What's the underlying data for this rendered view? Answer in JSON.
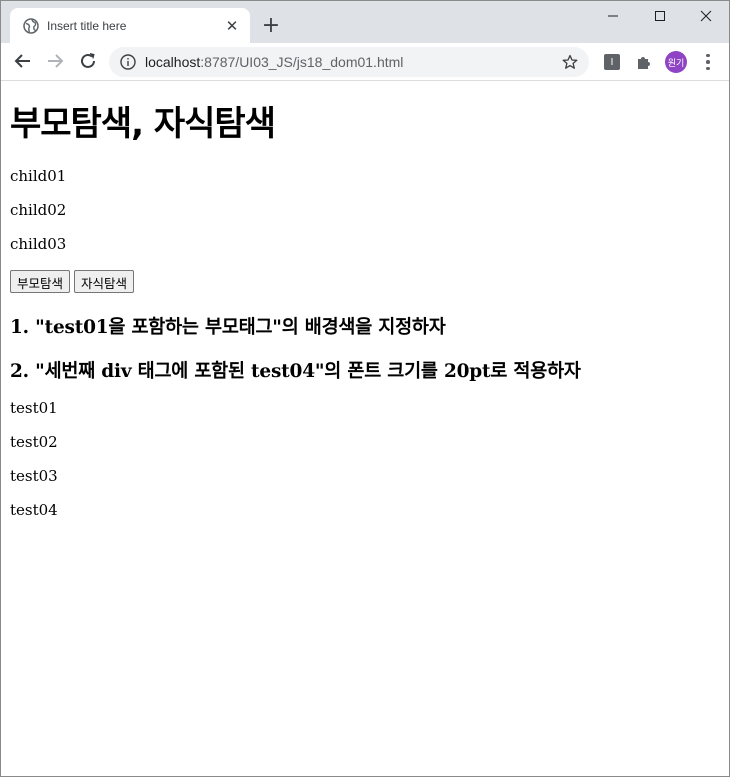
{
  "browser": {
    "tab_title": "Insert title here",
    "url_host": "localhost",
    "url_path": ":8787/UI03_JS/js18_dom01.html",
    "extension_label": "I",
    "profile_label": "원기"
  },
  "page": {
    "heading": "부모탐색, 자식탐색",
    "children": [
      "child01",
      "child02",
      "child03"
    ],
    "buttons": {
      "parent_search": "부모탐색",
      "child_search": "자식탐색"
    },
    "task1": "1. \"test01을 포함하는 부모태그\"의 배경색을 지정하자",
    "task2": "2. \"세번째 div 태그에 포함된 test04\"의 폰트 크기를 20pt로 적용하자",
    "tests": [
      "test01",
      "test02",
      "test03",
      "test04"
    ]
  },
  "colors": {
    "tabstrip_bg": "#dee1e6",
    "omnibox_bg": "#f1f3f4",
    "avatar_bg": "#8e44c4"
  }
}
